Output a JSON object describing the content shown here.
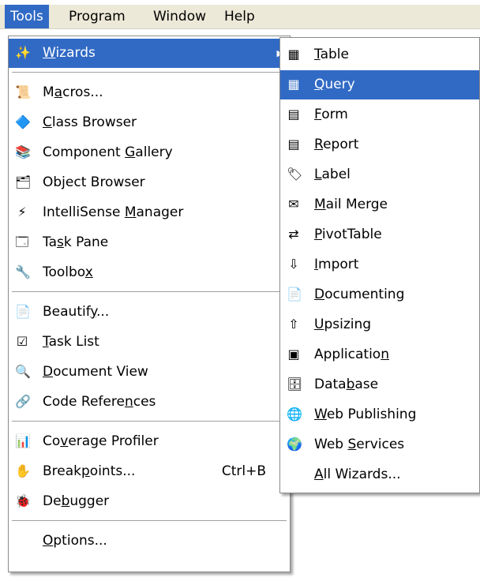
{
  "menubar": {
    "items": [
      {
        "label": "Tools",
        "active": true
      },
      {
        "label": "Program",
        "active": false
      },
      {
        "label": "Window",
        "active": false
      },
      {
        "label": "Help",
        "active": false
      }
    ]
  },
  "tools_menu": {
    "sections": [
      [
        {
          "id": "wizards",
          "label": "Wizards",
          "mn": "W",
          "icon": "wizard-wand-icon",
          "glyph": "✨",
          "submenu": true,
          "highlighted": true
        }
      ],
      [
        {
          "id": "macros",
          "label": "Macros...",
          "mn": "a",
          "icon": "macros-icon",
          "glyph": "📜"
        },
        {
          "id": "class-browser",
          "label": "Class Browser",
          "mn": "C",
          "icon": "class-browser-icon",
          "glyph": "🔷"
        },
        {
          "id": "component-gallery",
          "label": "Component Gallery",
          "mn": "G",
          "icon": "component-gallery-icon",
          "glyph": "📚"
        },
        {
          "id": "object-browser",
          "label": "Object Browser",
          "mn": "j",
          "icon": "object-browser-icon",
          "glyph": "🗂"
        },
        {
          "id": "intellisense-manager",
          "label": "IntelliSense Manager",
          "mn": "M",
          "icon": "intellisense-icon",
          "glyph": "⚡"
        },
        {
          "id": "task-pane",
          "label": "Task Pane",
          "mn": "s",
          "icon": "task-pane-icon",
          "glyph": "🗔"
        },
        {
          "id": "toolbox",
          "label": "Toolbox",
          "mn": "x",
          "icon": "toolbox-icon",
          "glyph": "🔧"
        }
      ],
      [
        {
          "id": "beautify",
          "label": "Beautify...",
          "mn": "y",
          "icon": "beautify-icon",
          "glyph": "📄"
        },
        {
          "id": "task-list",
          "label": "Task List",
          "mn": "T",
          "icon": "task-list-icon",
          "glyph": "☑"
        },
        {
          "id": "document-view",
          "label": "Document View",
          "mn": "D",
          "icon": "document-view-icon",
          "glyph": "🔍"
        },
        {
          "id": "code-references",
          "label": "Code References",
          "mn": "n",
          "icon": "code-references-icon",
          "glyph": "🔗"
        }
      ],
      [
        {
          "id": "coverage-profiler",
          "label": "Coverage Profiler",
          "mn": "v",
          "icon": "coverage-profiler-icon",
          "glyph": "📊"
        },
        {
          "id": "breakpoints",
          "label": "Breakpoints...",
          "mn": "p",
          "icon": "breakpoints-icon",
          "glyph": "✋",
          "shortcut": "Ctrl+B"
        },
        {
          "id": "debugger",
          "label": "Debugger",
          "mn": "b",
          "icon": "debugger-icon",
          "glyph": "🐞"
        }
      ],
      [
        {
          "id": "options",
          "label": "Options...",
          "mn": "O",
          "icon": "",
          "glyph": ""
        }
      ]
    ]
  },
  "wizards_submenu": {
    "items": [
      {
        "id": "table",
        "label": "Table",
        "mn": "T",
        "icon": "table-wizard-icon",
        "glyph": "▦"
      },
      {
        "id": "query",
        "label": "Query",
        "mn": "Q",
        "icon": "query-wizard-icon",
        "glyph": "▦",
        "highlighted": true
      },
      {
        "id": "form",
        "label": "Form",
        "mn": "F",
        "icon": "form-wizard-icon",
        "glyph": "▤"
      },
      {
        "id": "report",
        "label": "Report",
        "mn": "R",
        "icon": "report-wizard-icon",
        "glyph": "▤"
      },
      {
        "id": "label",
        "label": "Label",
        "mn": "L",
        "icon": "label-wizard-icon",
        "glyph": "🏷"
      },
      {
        "id": "mail-merge",
        "label": "Mail Merge",
        "mn": "M",
        "icon": "mail-merge-wizard-icon",
        "glyph": "✉"
      },
      {
        "id": "pivottable",
        "label": "PivotTable",
        "mn": "P",
        "icon": "pivottable-wizard-icon",
        "glyph": "⇄"
      },
      {
        "id": "import",
        "label": "Import",
        "mn": "I",
        "icon": "import-wizard-icon",
        "glyph": "⇩"
      },
      {
        "id": "documenting",
        "label": "Documenting",
        "mn": "D",
        "icon": "documenting-wizard-icon",
        "glyph": "📄"
      },
      {
        "id": "upsizing",
        "label": "Upsizing",
        "mn": "U",
        "icon": "upsizing-wizard-icon",
        "glyph": "⇧"
      },
      {
        "id": "application",
        "label": "Application",
        "mn": "n",
        "icon": "application-wizard-icon",
        "glyph": "▣"
      },
      {
        "id": "database",
        "label": "Database",
        "mn": "b",
        "icon": "database-wizard-icon",
        "glyph": "🗄"
      },
      {
        "id": "web-publishing",
        "label": "Web Publishing",
        "mn": "W",
        "icon": "web-publishing-wizard-icon",
        "glyph": "🌐"
      },
      {
        "id": "web-services",
        "label": "Web Services",
        "mn": "S",
        "icon": "web-services-wizard-icon",
        "glyph": "🌍"
      },
      {
        "id": "all-wizards",
        "label": "All Wizards...",
        "mn": "A",
        "icon": "",
        "glyph": ""
      }
    ]
  }
}
